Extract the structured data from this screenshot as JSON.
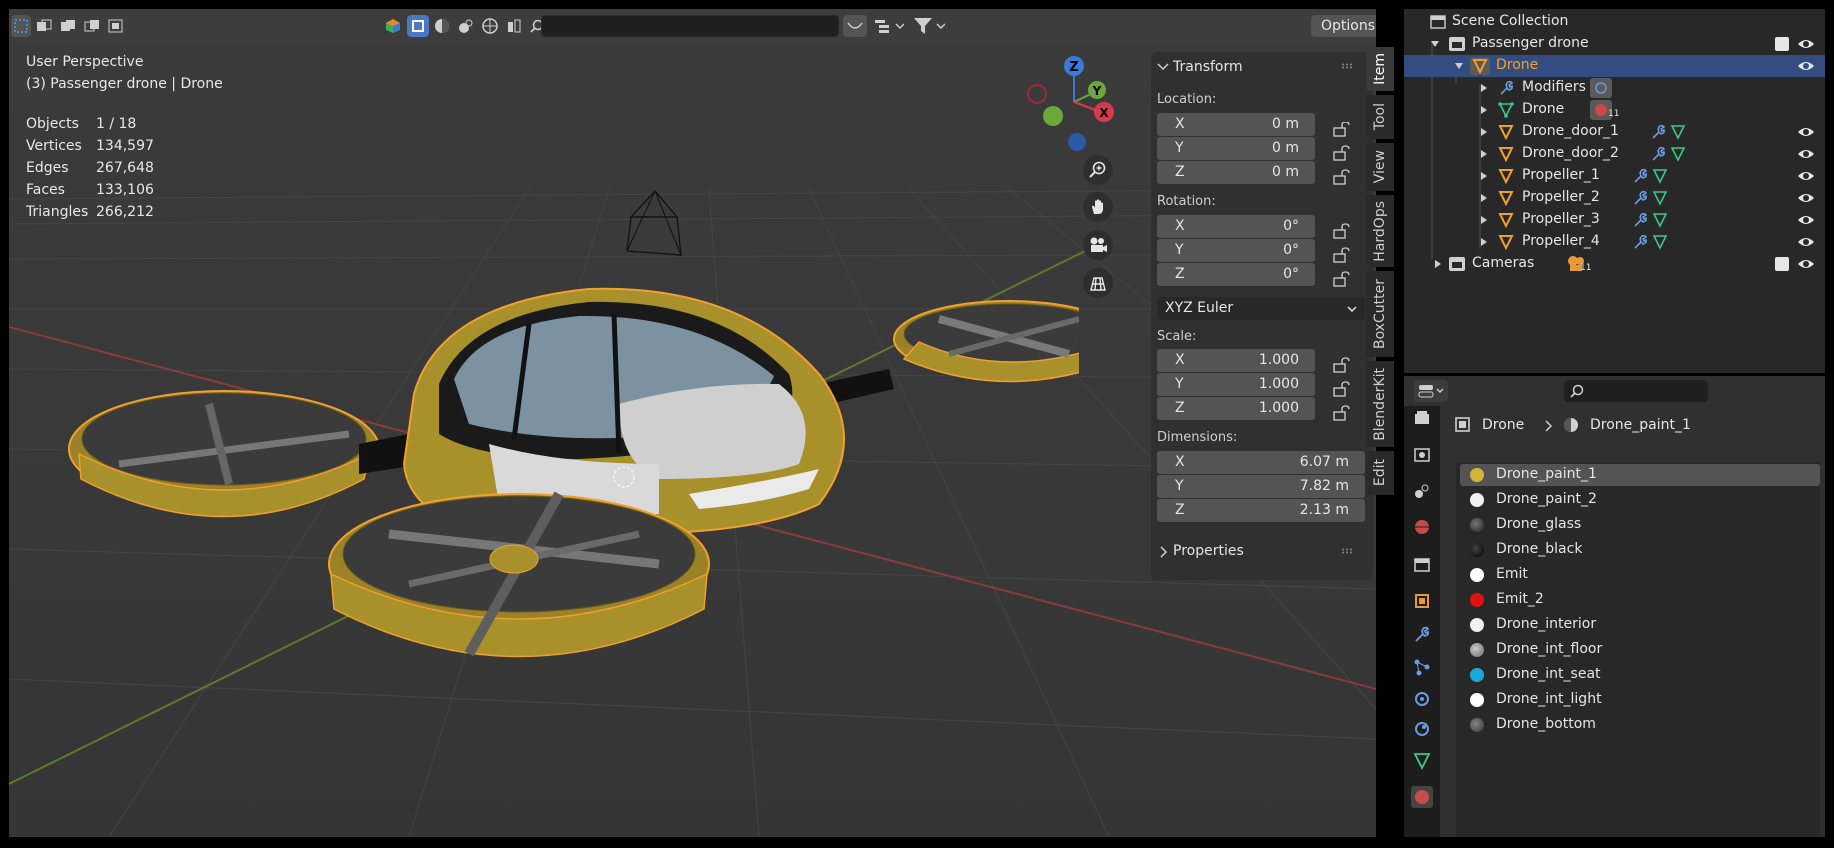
{
  "viewport": {
    "header": {
      "options_label": "Options"
    },
    "overlay": {
      "perspective": "User Perspective",
      "object_info": "(3) Passenger drone | Drone",
      "stats": [
        {
          "label": "Objects",
          "value": "1 / 18"
        },
        {
          "label": "Vertices",
          "value": "134,597"
        },
        {
          "label": "Edges",
          "value": "267,648"
        },
        {
          "label": "Faces",
          "value": "133,106"
        },
        {
          "label": "Triangles",
          "value": "266,212"
        }
      ]
    },
    "gizmo": {
      "x": "X",
      "y": "Y",
      "z": "Z"
    }
  },
  "npanel": {
    "transform_title": "Transform",
    "location_label": "Location:",
    "location": [
      {
        "axis": "X",
        "value": "0 m"
      },
      {
        "axis": "Y",
        "value": "0 m"
      },
      {
        "axis": "Z",
        "value": "0 m"
      }
    ],
    "rotation_label": "Rotation:",
    "rotation": [
      {
        "axis": "X",
        "value": "0°"
      },
      {
        "axis": "Y",
        "value": "0°"
      },
      {
        "axis": "Z",
        "value": "0°"
      }
    ],
    "rotation_mode": "XYZ Euler",
    "scale_label": "Scale:",
    "scale": [
      {
        "axis": "X",
        "value": "1.000"
      },
      {
        "axis": "Y",
        "value": "1.000"
      },
      {
        "axis": "Z",
        "value": "1.000"
      }
    ],
    "dimensions_label": "Dimensions:",
    "dimensions": [
      {
        "axis": "X",
        "value": "6.07 m"
      },
      {
        "axis": "Y",
        "value": "7.82 m"
      },
      {
        "axis": "Z",
        "value": "2.13 m"
      }
    ],
    "properties_title": "Properties"
  },
  "tabs": [
    "Item",
    "Tool",
    "View",
    "HardOps",
    "BoxCutter",
    "BlenderKit",
    "Edit"
  ],
  "outliner": {
    "rows": [
      {
        "label": "Scene Collection"
      },
      {
        "label": "Passenger drone"
      },
      {
        "label": "Drone"
      },
      {
        "label": "Modifiers"
      },
      {
        "label": "Drone",
        "badge": "11"
      },
      {
        "label": "Drone_door_1"
      },
      {
        "label": "Drone_door_2"
      },
      {
        "label": "Propeller_1"
      },
      {
        "label": "Propeller_2"
      },
      {
        "label": "Propeller_3"
      },
      {
        "label": "Propeller_4"
      },
      {
        "label": "Cameras",
        "badge": "11"
      }
    ]
  },
  "properties": {
    "breadcrumb_object": "Drone",
    "breadcrumb_material": "Drone_paint_1",
    "materials": [
      {
        "name": "Drone_paint_1",
        "color": "#d6b43a"
      },
      {
        "name": "Drone_paint_2",
        "color": "#f2f2f2"
      },
      {
        "name": "Drone_glass",
        "color": "#3a3a3a"
      },
      {
        "name": "Drone_black",
        "color": "#111111"
      },
      {
        "name": "Emit",
        "color": "#ffffff"
      },
      {
        "name": "Emit_2",
        "color": "#e01010"
      },
      {
        "name": "Drone_interior",
        "color": "#f0f0f0"
      },
      {
        "name": "Drone_int_floor",
        "color": "#9a9a9a"
      },
      {
        "name": "Drone_int_seat",
        "color": "#19a8d8"
      },
      {
        "name": "Drone_int_light",
        "color": "#ffffff"
      },
      {
        "name": "Drone_bottom",
        "color": "#555555"
      }
    ]
  },
  "colors": {
    "selection_outline": "#f0a030",
    "drone_body": "#a8902a",
    "outliner_selection": "#334d80"
  }
}
